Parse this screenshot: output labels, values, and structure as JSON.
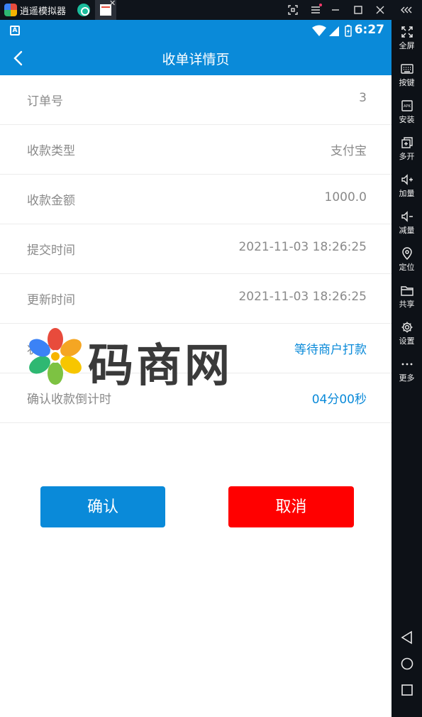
{
  "emulator": {
    "title": "逍遥模拟器",
    "tab_close": "✕",
    "sidebar": [
      {
        "icon": "fullscreen-icon",
        "label": "全屏"
      },
      {
        "icon": "keyboard-icon",
        "label": "按键"
      },
      {
        "icon": "apk-install-icon",
        "label": "安装"
      },
      {
        "icon": "multi-open-icon",
        "label": "多开"
      },
      {
        "icon": "volume-up-icon",
        "label": "加量"
      },
      {
        "icon": "volume-down-icon",
        "label": "减量"
      },
      {
        "icon": "location-pin-icon",
        "label": "定位"
      },
      {
        "icon": "folder-icon",
        "label": "共享"
      },
      {
        "icon": "gear-icon",
        "label": "设置"
      },
      {
        "icon": "more-dots-icon",
        "label": "更多"
      }
    ]
  },
  "statusbar": {
    "time": "6:27",
    "left_icon": "A"
  },
  "appbar": {
    "title": "收单详情页"
  },
  "details": [
    {
      "label": "订单号",
      "value": "3",
      "accent": false
    },
    {
      "label": "收款类型",
      "value": "支付宝",
      "accent": false
    },
    {
      "label": "收款金额",
      "value": "1000.0",
      "accent": false
    },
    {
      "label": "提交时间",
      "value": "2021-11-03 18:26:25",
      "accent": false
    },
    {
      "label": "更新时间",
      "value": "2021-11-03 18:26:25",
      "accent": false
    },
    {
      "label": "状态",
      "value": "等待商户打款",
      "accent": true
    },
    {
      "label": "确认收款倒计时",
      "value": "04分00秒",
      "accent": true
    }
  ],
  "watermark": {
    "text": "码商网"
  },
  "buttons": {
    "confirm": "确认",
    "cancel": "取消"
  },
  "colors": {
    "primary": "#0a8ad9",
    "danger": "#ff0000",
    "muted_text": "#8a8a8a"
  }
}
